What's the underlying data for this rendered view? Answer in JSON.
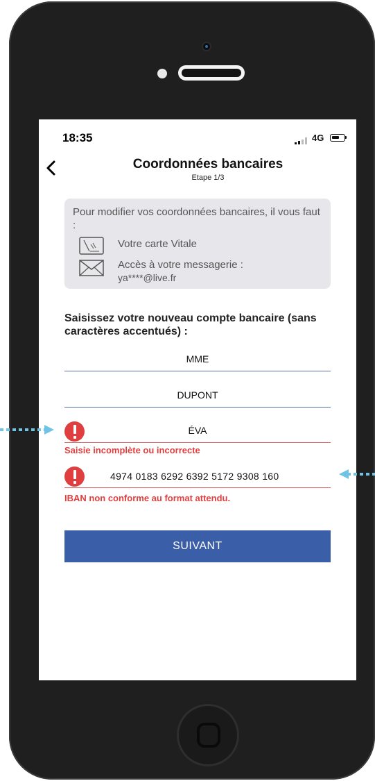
{
  "status_bar": {
    "time": "18:35",
    "network": "4G"
  },
  "header": {
    "title": "Coordonnées bancaires",
    "subtitle": "Etape 1/3"
  },
  "info": {
    "intro": "Pour modifier vos coordonnées bancaires, il vous faut :",
    "card_label": "Votre carte Vitale",
    "mail_label": "Accès à votre messagerie :",
    "mail_address": "ya****@live.fr"
  },
  "form": {
    "prompt": "Saisissez votre nouveau compte bancaire (sans caractères accentués) :",
    "civility": "MME",
    "last_name": "DUPONT",
    "first_name": "ÉVA",
    "first_name_error": "Saisie incomplète ou incorrecte",
    "iban": "4974 0183 6292 6392 5172 9308 160",
    "iban_error": "IBAN non conforme au format attendu."
  },
  "next_button": {
    "label": "SUIVANT"
  },
  "colors": {
    "accent": "#3a5ea8",
    "error": "#e03f3f",
    "annotation_arrow": "#6fc4e6"
  },
  "icons": {
    "back": "chevron-left-icon",
    "card": "vitale-card-icon",
    "mail": "envelope-icon",
    "error": "exclamation-circle-icon"
  }
}
